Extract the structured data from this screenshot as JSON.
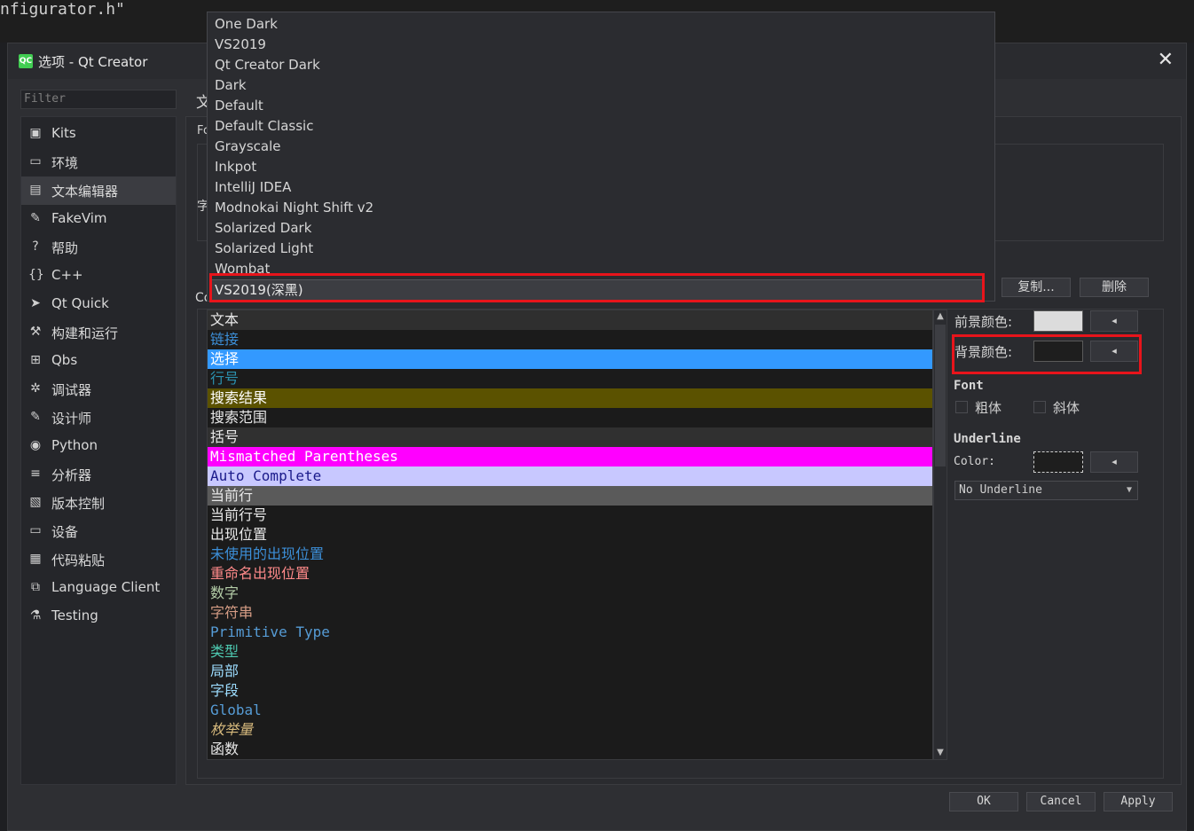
{
  "background_editor": {
    "code_text": "nfigurator.h\""
  },
  "window": {
    "title": "选项 - Qt Creator",
    "icon_text": "QC",
    "close_glyph": "✕"
  },
  "sidebar": {
    "filter_placeholder": "Filter",
    "items": [
      {
        "label": "Kits",
        "icon": "▣"
      },
      {
        "label": "环境",
        "icon": "▭"
      },
      {
        "label": "文本编辑器",
        "icon": "▤"
      },
      {
        "label": "FakeVim",
        "icon": "✎"
      },
      {
        "label": "帮助",
        "icon": "?"
      },
      {
        "label": "C++",
        "icon": "{}"
      },
      {
        "label": "Qt Quick",
        "icon": "➤"
      },
      {
        "label": "构建和运行",
        "icon": "⚒"
      },
      {
        "label": "Qbs",
        "icon": "⊞"
      },
      {
        "label": "调试器",
        "icon": "✲"
      },
      {
        "label": "设计师",
        "icon": "✎"
      },
      {
        "label": "Python",
        "icon": "◉"
      },
      {
        "label": "分析器",
        "icon": "≡"
      },
      {
        "label": "版本控制",
        "icon": "▧"
      },
      {
        "label": "设备",
        "icon": "▭"
      },
      {
        "label": "代码粘贴",
        "icon": "▦"
      },
      {
        "label": "Language Client",
        "icon": "⧉"
      },
      {
        "label": "Testing",
        "icon": "⚗"
      }
    ]
  },
  "main": {
    "title_fragment": "文",
    "tab_fragment": "Fo",
    "frag_zi": "字",
    "frag_co": "Co",
    "copy_label": "复制...",
    "delete_label": "删除"
  },
  "scheme_dropdown": {
    "options": [
      "One Dark",
      "VS2019",
      "Qt Creator Dark",
      "Dark",
      "Default",
      "Default Classic",
      "Grayscale",
      "Inkpot",
      "IntelliJ IDEA",
      "Modnokai Night Shift v2",
      "Solarized Dark",
      "Solarized Light",
      "Wombat"
    ],
    "selected": "VS2019(深黑)"
  },
  "color_list": [
    {
      "label": "文本",
      "fg": "#e8e8e8",
      "bg": "#2f2f2f",
      "mono": false
    },
    {
      "label": "链接",
      "fg": "#3c8fd8",
      "bg": "#1b1b1b",
      "mono": false
    },
    {
      "label": "选择",
      "fg": "#ffffff",
      "bg": "#3399ff",
      "mono": false
    },
    {
      "label": "行号",
      "fg": "#2b91af",
      "bg": "#1b1b1b",
      "mono": false
    },
    {
      "label": "搜索结果",
      "fg": "#ffffff",
      "bg": "#5b5200",
      "mono": false
    },
    {
      "label": "搜索范围",
      "fg": "#e8e8e8",
      "bg": "#1b1b1b",
      "mono": false
    },
    {
      "label": "括号",
      "fg": "#e8e8e8",
      "bg": "#303030",
      "mono": false
    },
    {
      "label": "Mismatched Parentheses",
      "fg": "#ffffff",
      "bg": "#ff00ff",
      "mono": true
    },
    {
      "label": "Auto Complete",
      "fg": "#1a1a8a",
      "bg": "#c8c8ff",
      "mono": true
    },
    {
      "label": "当前行",
      "fg": "#e8e8e8",
      "bg": "#5a5a5a",
      "mono": false
    },
    {
      "label": "当前行号",
      "fg": "#e8e8e8",
      "bg": "#1b1b1b",
      "mono": false
    },
    {
      "label": "出现位置",
      "fg": "#e8e8e8",
      "bg": "#1b1b1b",
      "mono": false
    },
    {
      "label": "未使用的出现位置",
      "fg": "#3c8fd8",
      "bg": "#1b1b1b",
      "mono": false
    },
    {
      "label": "重命名出现位置",
      "fg": "#ff8a8a",
      "bg": "#1b1b1b",
      "mono": false
    },
    {
      "label": "数字",
      "fg": "#b5cea8",
      "bg": "#1b1b1b",
      "mono": false
    },
    {
      "label": "字符串",
      "fg": "#d69d85",
      "bg": "#1b1b1b",
      "mono": false
    },
    {
      "label": "Primitive Type",
      "fg": "#569cd6",
      "bg": "#1b1b1b",
      "mono": true
    },
    {
      "label": "类型",
      "fg": "#4ec9b0",
      "bg": "#1b1b1b",
      "mono": false
    },
    {
      "label": "局部",
      "fg": "#9cdcfe",
      "bg": "#1b1b1b",
      "mono": false
    },
    {
      "label": "字段",
      "fg": "#9cdcfe",
      "bg": "#1b1b1b",
      "mono": false
    },
    {
      "label": "Global",
      "fg": "#569cd6",
      "bg": "#1b1b1b",
      "mono": true
    },
    {
      "label": "枚举量",
      "fg": "#d7ba7d",
      "bg": "#1b1b1b",
      "mono": false,
      "italic": true
    },
    {
      "label": "函数",
      "fg": "#e8e8e8",
      "bg": "#1b1b1b",
      "mono": false
    }
  ],
  "properties": {
    "foreground_label": "前景颜色:",
    "background_label": "背景颜色:",
    "foreground_color": "#dcdcdc",
    "background_color": "#1e1e1e",
    "arrow_glyph": "◂",
    "font_heading": "Font",
    "bold_label": "粗体",
    "italic_label": "斜体",
    "underline_heading": "Underline",
    "underline_color_label": "Color:",
    "underline_style": "No Underline"
  },
  "footer": {
    "ok": "OK",
    "cancel": "Cancel",
    "apply": "Apply"
  }
}
